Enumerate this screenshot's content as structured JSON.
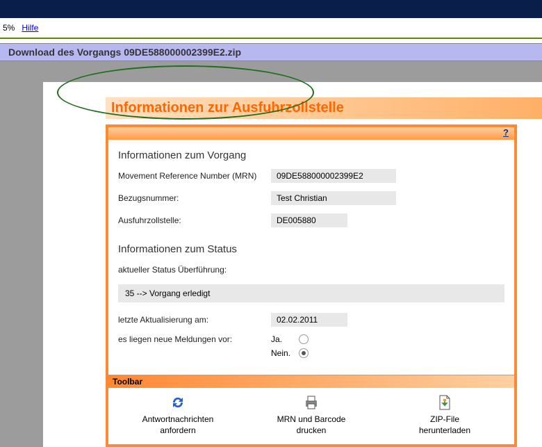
{
  "nav": {
    "pct": "5%",
    "help": "Hilfe"
  },
  "download_bar": {
    "prefix": "Download des Vorgangs  ",
    "file": "09DE588000002399E2.zip"
  },
  "heading": "Informationen zur Ausfuhrzollstelle",
  "help_q": "?",
  "vorgang": {
    "head": "Informationen zum Vorgang",
    "mrn_label": "Movement Reference Number (MRN)",
    "mrn_value": "09DE588000002399E2",
    "bezug_label": "Bezugsnummer:",
    "bezug_value": "Test Christian",
    "zoll_label": "Ausfuhrzollstelle:",
    "zoll_value": "DE005880"
  },
  "status": {
    "head": "Informationen zum Status",
    "aktuell_label": "aktueller Status Überführung:",
    "aktuell_value": "35 --> Vorgang erledigt",
    "updated_label": "letzte Aktualisierung am:",
    "updated_value": "02.02.2011",
    "meldungen_label": "es liegen neue Meldungen vor:",
    "ja": "Ja.",
    "nein": "Nein.",
    "selected": "nein"
  },
  "toolbar": {
    "header": "Toolbar",
    "btn1_l1": "Antwortnachrichten",
    "btn1_l2": "anfordern",
    "btn2_l1": "MRN und Barcode",
    "btn2_l2": "drucken",
    "btn3_l1": "ZIP-File",
    "btn3_l2": "herunterladen"
  }
}
